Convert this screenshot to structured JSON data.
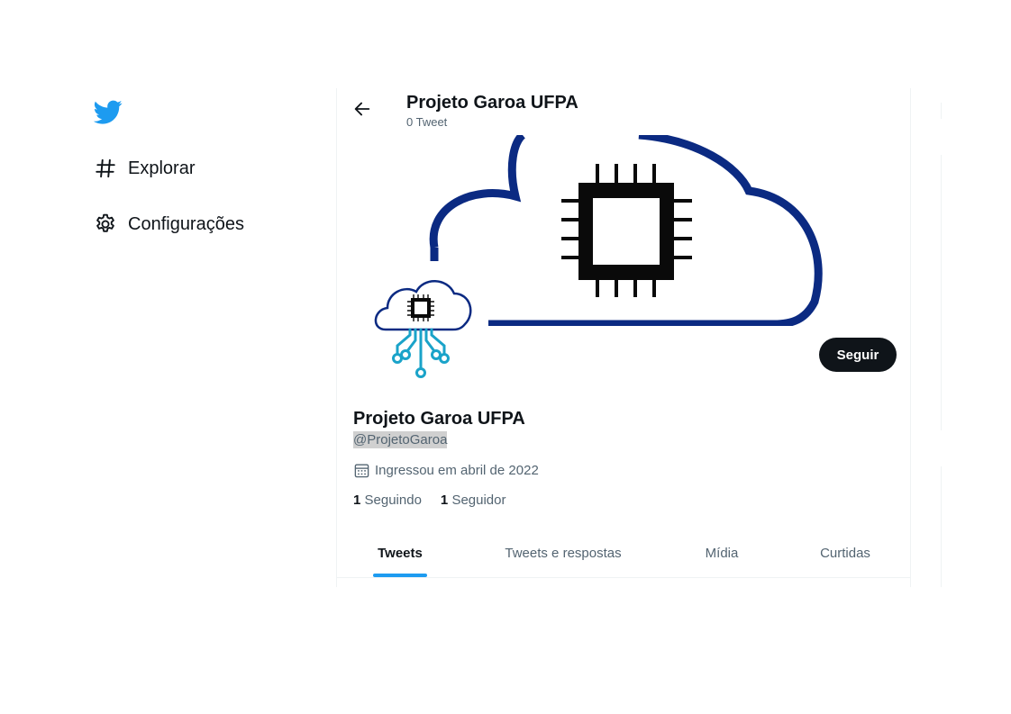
{
  "sidebar": {
    "logo_icon": "twitter-bird-icon",
    "items": [
      {
        "icon": "hashtag-icon",
        "label": "Explorar"
      },
      {
        "icon": "gear-icon",
        "label": "Configurações"
      }
    ]
  },
  "header": {
    "back_icon": "arrow-left-icon",
    "title": "Projeto Garoa UFPA",
    "subtitle": "0 Tweet"
  },
  "profile": {
    "banner_icon": "cloud-chip-icon",
    "avatar_icon": "cloud-chip-circuit-icon",
    "follow_label": "Seguir",
    "name": "Projeto Garoa UFPA",
    "handle": "@ProjetoGaroa",
    "joined_icon": "calendar-icon",
    "joined": "Ingressou em abril de 2022",
    "following_count": "1",
    "following_label": "Seguindo",
    "followers_count": "1",
    "followers_label": "Seguidor"
  },
  "tabs": [
    {
      "label": "Tweets",
      "active": true
    },
    {
      "label": "Tweets e respostas",
      "active": false
    },
    {
      "label": "Mídia",
      "active": false
    },
    {
      "label": "Curtidas",
      "active": false
    }
  ],
  "colors": {
    "twitter_blue": "#1d9bf0",
    "cloud_navy": "#0b2a82",
    "circuit_teal": "#1aa3c9",
    "text_primary": "#0f1419",
    "text_secondary": "#536471"
  }
}
